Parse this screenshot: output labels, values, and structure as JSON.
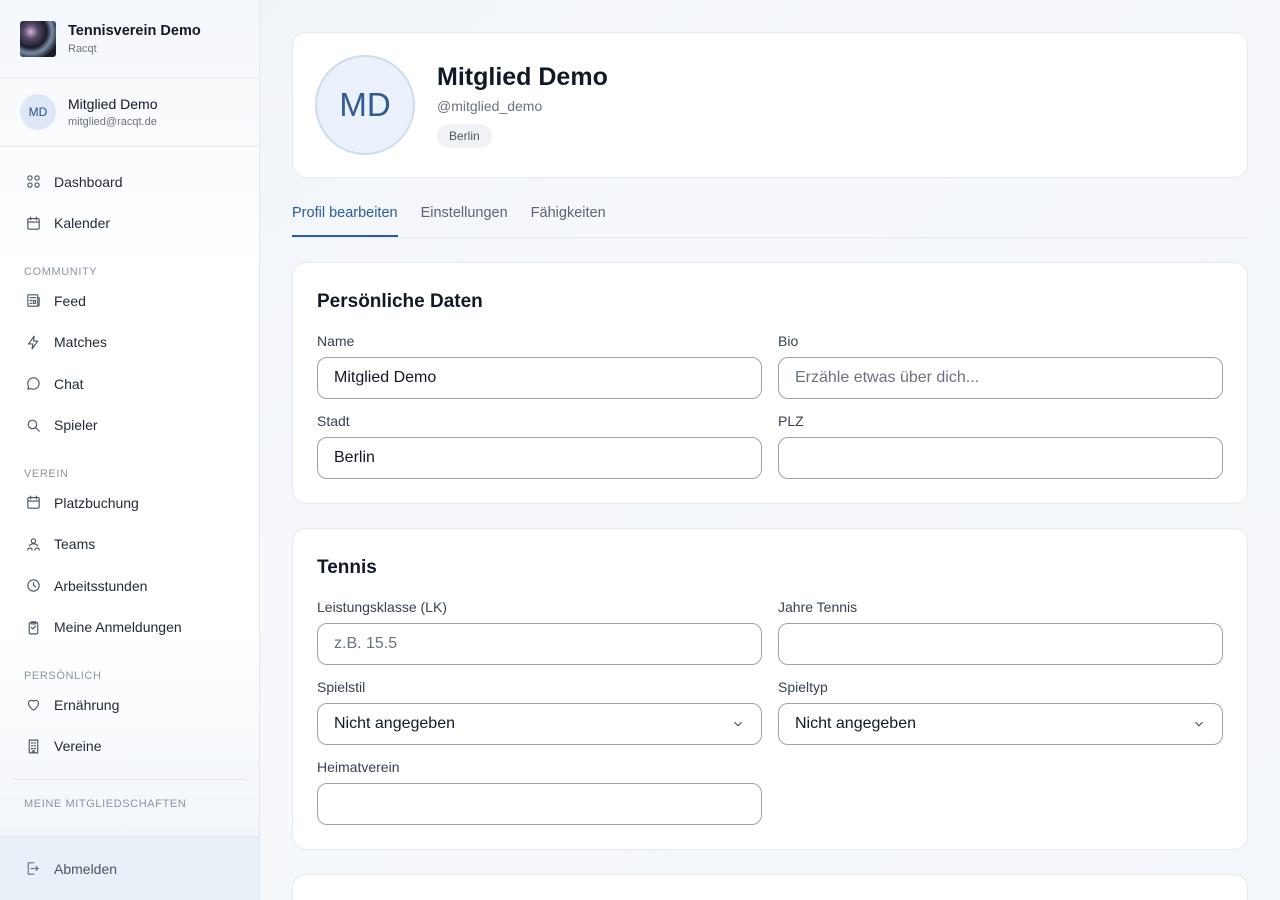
{
  "brand": {
    "title": "Tennisverein Demo",
    "subtitle": "Racqt"
  },
  "user": {
    "initials": "MD",
    "name": "Mitglied Demo",
    "email": "mitglied@racqt.de"
  },
  "nav": {
    "top": [
      {
        "label": "Dashboard",
        "icon": "grid-icon"
      },
      {
        "label": "Kalender",
        "icon": "calendar-icon"
      }
    ],
    "community_label": "COMMUNITY",
    "community": [
      {
        "label": "Feed",
        "icon": "newspaper-icon"
      },
      {
        "label": "Matches",
        "icon": "lightning-icon"
      },
      {
        "label": "Chat",
        "icon": "chat-icon"
      },
      {
        "label": "Spieler",
        "icon": "search-icon"
      }
    ],
    "verein_label": "VEREIN",
    "verein": [
      {
        "label": "Platzbuchung",
        "icon": "calendar-icon"
      },
      {
        "label": "Teams",
        "icon": "team-icon"
      },
      {
        "label": "Arbeitsstunden",
        "icon": "clock-icon"
      },
      {
        "label": "Meine Anmeldungen",
        "icon": "clipboard-icon"
      }
    ],
    "personal_label": "PERSÖNLICH",
    "personal": [
      {
        "label": "Ernährung",
        "icon": "heart-icon"
      },
      {
        "label": "Vereine",
        "icon": "building-icon"
      }
    ],
    "memberships_label": "MEINE MITGLIEDSCHAFTEN",
    "logout": "Abmelden"
  },
  "profile": {
    "initials": "MD",
    "name": "Mitglied Demo",
    "handle": "@mitglied_demo",
    "tag": "Berlin"
  },
  "tabs": [
    "Profil bearbeiten",
    "Einstellungen",
    "Fähigkeiten"
  ],
  "personal_data": {
    "title": "Persönliche Daten",
    "name_label": "Name",
    "name_value": "Mitglied Demo",
    "bio_label": "Bio",
    "bio_placeholder": "Erzähle etwas über dich...",
    "city_label": "Stadt",
    "city_value": "Berlin",
    "zip_label": "PLZ",
    "zip_value": ""
  },
  "tennis": {
    "title": "Tennis",
    "lk_label": "Leistungsklasse (LK)",
    "lk_placeholder": "z.B. 15.5",
    "years_label": "Jahre Tennis",
    "years_value": "",
    "style_label": "Spielstil",
    "style_value": "Nicht angegeben",
    "type_label": "Spieltyp",
    "type_value": "Nicht angegeben",
    "club_label": "Heimatverein",
    "club_value": ""
  }
}
